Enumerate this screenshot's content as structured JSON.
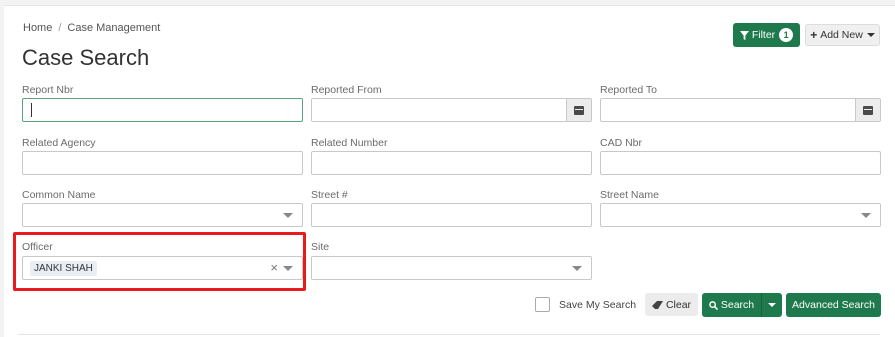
{
  "breadcrumb": {
    "home": "Home",
    "separator": "/",
    "current": "Case Management"
  },
  "page_title": "Case Search",
  "toolbar": {
    "filter_label": "Filter",
    "filter_count": "1",
    "add_new_label": "Add New"
  },
  "fields": {
    "report_nbr": {
      "label": "Report Nbr",
      "value": ""
    },
    "reported_from": {
      "label": "Reported From",
      "value": ""
    },
    "reported_to": {
      "label": "Reported To",
      "value": ""
    },
    "related_agency": {
      "label": "Related Agency",
      "value": ""
    },
    "related_number": {
      "label": "Related Number",
      "value": ""
    },
    "cad_nbr": {
      "label": "CAD Nbr",
      "value": ""
    },
    "common_name": {
      "label": "Common Name",
      "value": ""
    },
    "street_no": {
      "label": "Street #",
      "value": ""
    },
    "street_name": {
      "label": "Street Name",
      "value": ""
    },
    "officer": {
      "label": "Officer",
      "selected": "JANKI SHAH",
      "clear_glyph": "×"
    },
    "site": {
      "label": "Site",
      "value": ""
    }
  },
  "actions": {
    "save_my_search": "Save My Search",
    "clear": "Clear",
    "search": "Search",
    "advanced_search": "Advanced Search"
  },
  "colors": {
    "accent_green": "#1e7a4c",
    "highlight_red": "#e8191f",
    "focus_green": "#5aa37d"
  },
  "icons": {
    "filter": "filter-icon",
    "plus": "plus-icon",
    "calendar": "calendar-icon",
    "eraser": "eraser-icon",
    "search": "search-icon",
    "caret": "caret-down-icon"
  }
}
